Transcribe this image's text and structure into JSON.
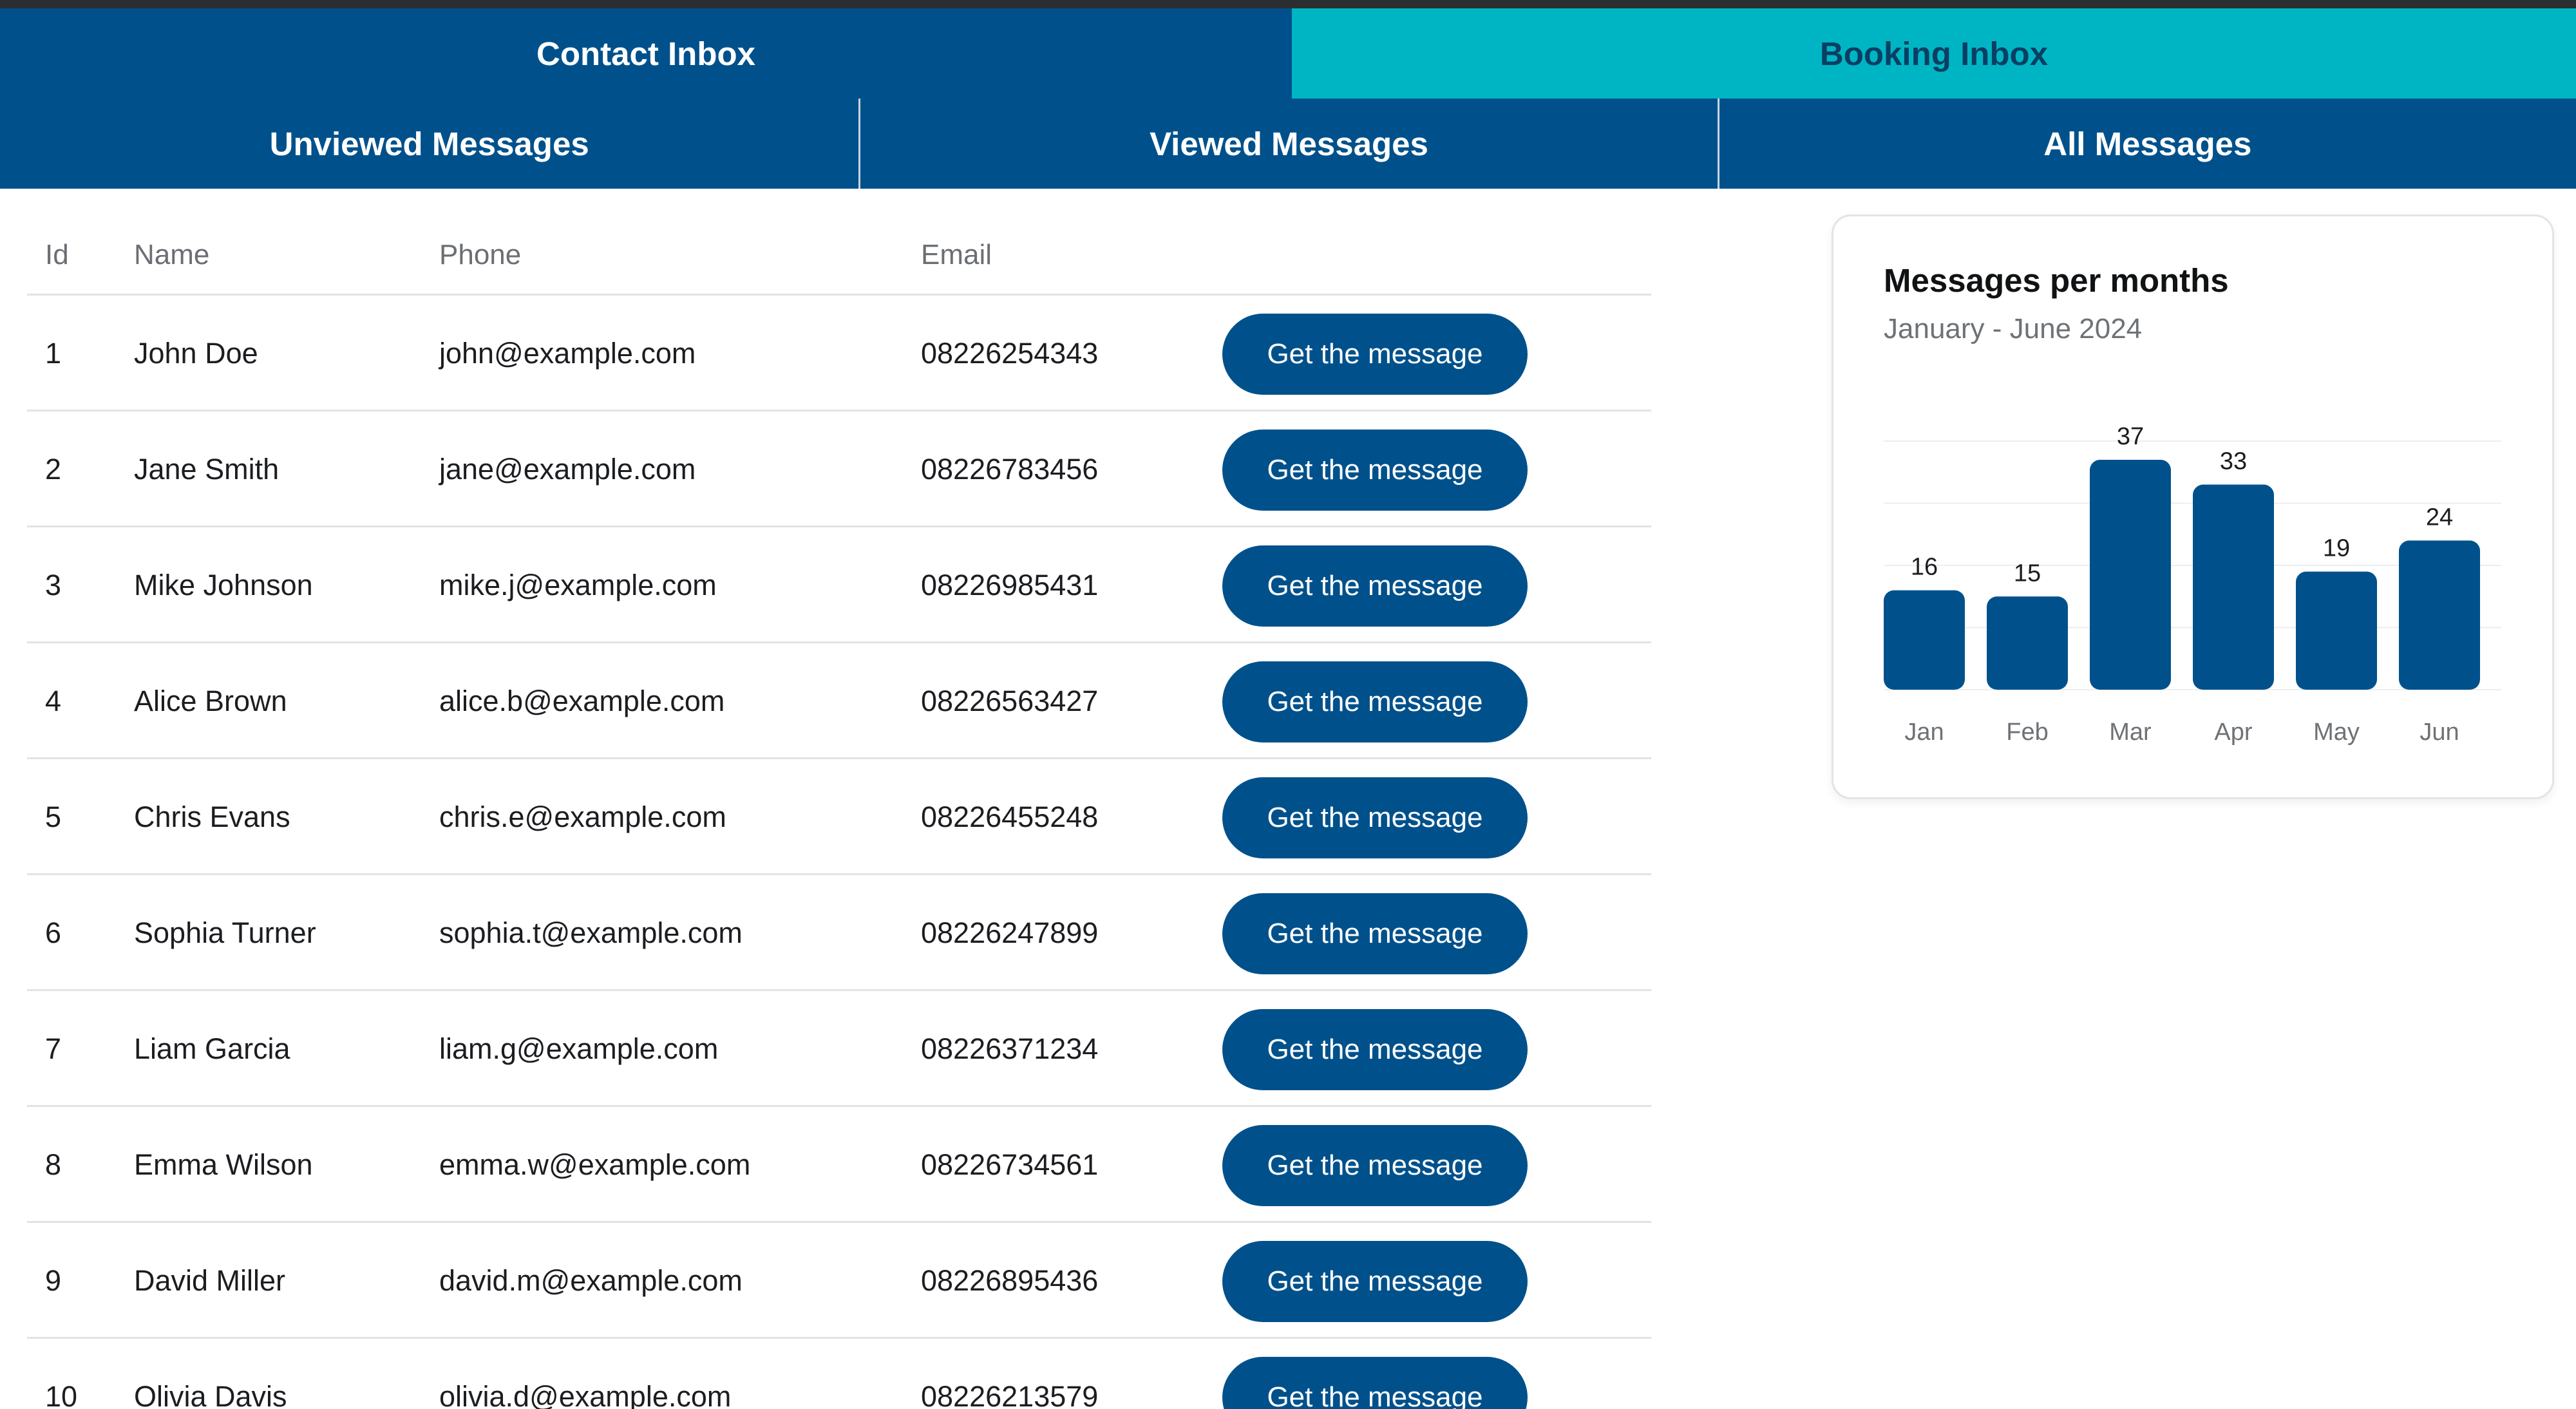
{
  "tabs": {
    "contact_inbox": "Contact Inbox",
    "booking_inbox": "Booking Inbox"
  },
  "subtabs": {
    "unviewed": "Unviewed Messages",
    "viewed": "Viewed Messages",
    "all": "All Messages"
  },
  "table": {
    "headers": {
      "id": "Id",
      "name": "Name",
      "phone": "Phone",
      "email": "Email"
    },
    "button_label": "Get the message",
    "rows": [
      {
        "id": "1",
        "name": "John Doe",
        "phone": "john@example.com",
        "email": "08226254343"
      },
      {
        "id": "2",
        "name": "Jane Smith",
        "phone": "jane@example.com",
        "email": "08226783456"
      },
      {
        "id": "3",
        "name": "Mike Johnson",
        "phone": "mike.j@example.com",
        "email": "08226985431"
      },
      {
        "id": "4",
        "name": "Alice Brown",
        "phone": "alice.b@example.com",
        "email": "08226563427"
      },
      {
        "id": "5",
        "name": "Chris Evans",
        "phone": "chris.e@example.com",
        "email": "08226455248"
      },
      {
        "id": "6",
        "name": "Sophia Turner",
        "phone": "sophia.t@example.com",
        "email": "08226247899"
      },
      {
        "id": "7",
        "name": "Liam Garcia",
        "phone": "liam.g@example.com",
        "email": "08226371234"
      },
      {
        "id": "8",
        "name": "Emma Wilson",
        "phone": "emma.w@example.com",
        "email": "08226734561"
      },
      {
        "id": "9",
        "name": "David Miller",
        "phone": "david.m@example.com",
        "email": "08226895436"
      },
      {
        "id": "10",
        "name": "Olivia Davis",
        "phone": "olivia.d@example.com",
        "email": "08226213579"
      }
    ]
  },
  "colors": {
    "primary": "#00518b",
    "booking_tab": "#00b5c3",
    "booking_text": "#0a3f63"
  },
  "chart_data": {
    "type": "bar",
    "title": "Messages per months",
    "subtitle": "January - June 2024",
    "categories": [
      "Jan",
      "Feb",
      "Mar",
      "Apr",
      "May",
      "Jun"
    ],
    "values": [
      16,
      15,
      37,
      33,
      19,
      24
    ],
    "data_labels": true,
    "grid": true,
    "color": "#00518b"
  }
}
